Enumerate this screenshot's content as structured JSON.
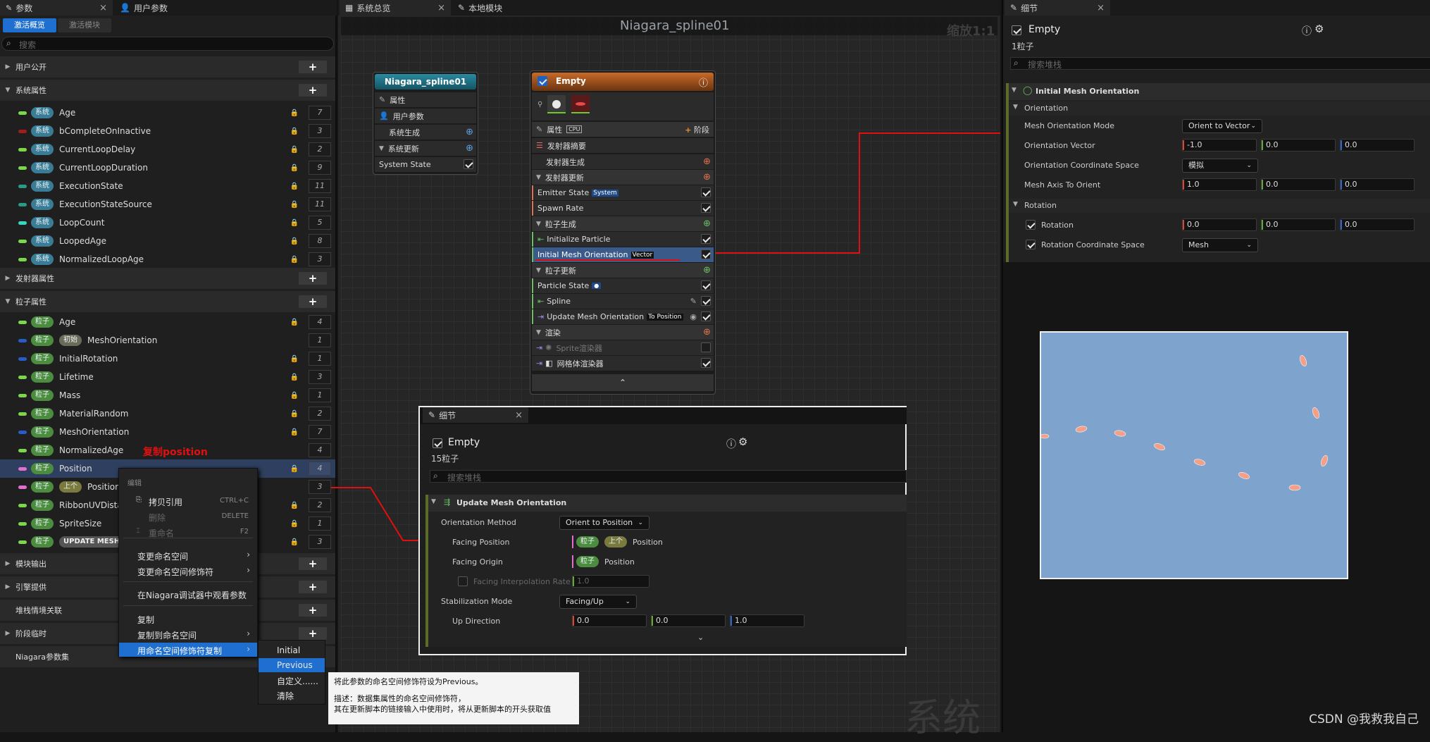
{
  "left_panel": {
    "tabs": [
      "参数",
      "用户参数"
    ],
    "subtabs": [
      "激活概览",
      "激活模块"
    ],
    "search_placeholder": "搜索",
    "sections": {
      "user_exposed": "用户公开",
      "system_attributes": "系统属性",
      "emitter_attributes": "发射器属性",
      "particle_attributes": "粒子属性",
      "module_outputs": "模块输出",
      "engine_provided": "引擎提供",
      "stack_context": "堆栈情境关联",
      "stage_transient": "阶段临时",
      "niagara_param_collection": "Niagara参数集"
    },
    "system_params": [
      {
        "ns": "系统",
        "name": "Age",
        "count": "7",
        "color": "#7cd64a"
      },
      {
        "ns": "系统",
        "name": "bCompleteOnInactive",
        "count": "3",
        "color": "#a11d1d"
      },
      {
        "ns": "系统",
        "name": "CurrentLoopDelay",
        "count": "2",
        "color": "#7cd64a"
      },
      {
        "ns": "系统",
        "name": "CurrentLoopDuration",
        "count": "9",
        "color": "#7cd64a"
      },
      {
        "ns": "系统",
        "name": "ExecutionState",
        "count": "11",
        "color": "#2a9a86"
      },
      {
        "ns": "系统",
        "name": "ExecutionStateSource",
        "count": "11",
        "color": "#2a9a86"
      },
      {
        "ns": "系统",
        "name": "LoopCount",
        "count": "5",
        "color": "#36d6c0"
      },
      {
        "ns": "系统",
        "name": "LoopedAge",
        "count": "8",
        "color": "#7cd64a"
      },
      {
        "ns": "系统",
        "name": "NormalizedLoopAge",
        "count": "3",
        "color": "#7cd64a"
      }
    ],
    "particle_params": [
      {
        "ns": "粒子",
        "tag": "",
        "name": "Age",
        "count": "4",
        "color": "#7cd64a"
      },
      {
        "ns": "粒子",
        "tag": "初始",
        "name": "MeshOrientation",
        "count": "1",
        "color": "#2a5cc8"
      },
      {
        "ns": "粒子",
        "tag": "",
        "name": "InitialRotation",
        "count": "1",
        "color": "#2a5cc8"
      },
      {
        "ns": "粒子",
        "tag": "",
        "name": "Lifetime",
        "count": "3",
        "color": "#7cd64a"
      },
      {
        "ns": "粒子",
        "tag": "",
        "name": "Mass",
        "count": "1",
        "color": "#7cd64a"
      },
      {
        "ns": "粒子",
        "tag": "",
        "name": "MaterialRandom",
        "count": "2",
        "color": "#7cd64a"
      },
      {
        "ns": "粒子",
        "tag": "",
        "name": "MeshOrientation",
        "count": "7",
        "color": "#2a5cc8"
      },
      {
        "ns": "粒子",
        "tag": "",
        "name": "NormalizedAge",
        "count": "4",
        "color": "#7cd64a"
      },
      {
        "ns": "粒子",
        "tag": "",
        "name": "Position",
        "count": "4",
        "color": "#e070d0"
      },
      {
        "ns": "粒子",
        "tag": "上个",
        "name": "Position",
        "count": "3",
        "color": "#e070d0"
      },
      {
        "ns": "粒子",
        "tag": "",
        "name": "RibbonUVDista",
        "count": "2",
        "color": "#7cd64a"
      },
      {
        "ns": "粒子",
        "tag": "",
        "name": "SpriteSize",
        "count": "1",
        "color": "#7cd64a"
      },
      {
        "ns": "粒子",
        "tag": "UPDATE MESH",
        "name": "",
        "count": "3",
        "color": "#7cd64a"
      }
    ],
    "annotation_copy_position": "复制position"
  },
  "context_menu": {
    "header": "编辑",
    "items": [
      {
        "label": "拷贝引用",
        "shortcut": "CTRL+C"
      },
      {
        "label": "删除",
        "shortcut": "DELETE"
      },
      {
        "label": "重命名",
        "shortcut": "F2"
      },
      {
        "label": "变更命名空间",
        "shortcut": ""
      },
      {
        "label": "变更命名空间修饰符",
        "shortcut": ""
      },
      {
        "label": "在Niagara调试器中观看参数",
        "shortcut": ""
      },
      {
        "label": "复制",
        "shortcut": ""
      },
      {
        "label": "复制到命名空间",
        "shortcut": ""
      },
      {
        "label": "用命名空间修饰符复制",
        "shortcut": ""
      }
    ],
    "submenu": [
      "Initial",
      "Previous",
      "自定义......",
      "清除"
    ],
    "tooltip_line1": "将此参数的命名空间修饰符设为Previous。",
    "tooltip_line2": "描述：数据集属性的命名空间修饰符，",
    "tooltip_line3": "其在更新脚本的链接输入中使用时，将从更新脚本的开头获取值"
  },
  "graph": {
    "tabs": [
      "系统总览",
      "本地模块"
    ],
    "title": "Niagara_spline01",
    "zoom": "缩放1:1",
    "watermark": "系统",
    "system_node": {
      "title": "Niagara_spline01",
      "rows": [
        "属性",
        "用户参数",
        "系统生成",
        "系统更新",
        "System State"
      ]
    },
    "emitter_node": {
      "title": "Empty",
      "props_label": "属性",
      "cpu": "CPU",
      "stage": "阶段",
      "rows": {
        "emitter_summary": "发射器摘要",
        "emitter_spawn": "发射器生成",
        "emitter_update": "发射器更新",
        "emitter_state": "Emitter State",
        "system_tag": "System",
        "spawn_rate": "Spawn Rate",
        "particle_spawn": "粒子生成",
        "init_particle": "Initialize Particle",
        "init_mesh": "Initial Mesh Orientation",
        "vector_tag": "Vector",
        "particle_update": "粒子更新",
        "particle_state": "Particle State",
        "spline": "Spline",
        "update_mesh": "Update Mesh Orientation",
        "to_position": "To Position",
        "render": "渲染",
        "sprite_renderer": "Sprite渲染器",
        "mesh_renderer": "网格体渲染器"
      }
    }
  },
  "detail_floating": {
    "tab": "细节",
    "name": "Empty",
    "count": "15粒子",
    "search_placeholder": "搜索堆栈",
    "section": "Update Mesh Orientation",
    "orientation_method_label": "Orientation Method",
    "orientation_method_value": "Orient to Position",
    "facing_position_label": "Facing Position",
    "facing_origin_label": "Facing Origin",
    "facing_interp_label": "Facing Interpolation Rate",
    "facing_interp_value": "1.0",
    "ns_particle": "粒子",
    "ns_prev": "上个",
    "position": "Position",
    "stabilization_label": "Stabilization Mode",
    "stabilization_value": "Facing/Up",
    "up_direction_label": "Up Direction",
    "up_direction": [
      "0.0",
      "0.0",
      "1.0"
    ]
  },
  "detail_right": {
    "tab": "细节",
    "name": "Empty",
    "count": "1粒子",
    "search_placeholder": "搜索堆栈",
    "section": "Initial Mesh Orientation",
    "orientation_group": "Orientation",
    "mesh_orientation_mode_label": "Mesh Orientation Mode",
    "mesh_orientation_mode_value": "Orient to Vector",
    "orientation_vector_label": "Orientation Vector",
    "orientation_vector": [
      "-1.0",
      "0.0",
      "0.0"
    ],
    "coord_space_label": "Orientation Coordinate Space",
    "coord_space_value": "模拟",
    "mesh_axis_label": "Mesh Axis To Orient",
    "mesh_axis": [
      "1.0",
      "0.0",
      "0.0"
    ],
    "rotation_group": "Rotation",
    "rotation_label": "Rotation",
    "rotation": [
      "0.0",
      "0.0",
      "0.0"
    ],
    "rotation_space_label": "Rotation Coordinate Space",
    "rotation_space_value": "Mesh"
  },
  "footer_credit": "CSDN @我救我自己",
  "colors": {
    "accent": "#1f6fd0",
    "annotation_red": "#e01010",
    "viewport_sky": "#7ea3cc"
  }
}
